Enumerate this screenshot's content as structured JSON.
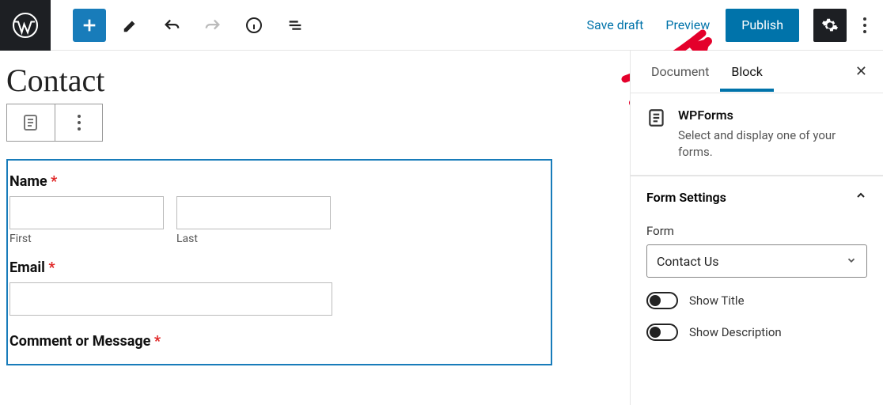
{
  "topbar": {
    "save_draft": "Save draft",
    "preview": "Preview",
    "publish": "Publish"
  },
  "page": {
    "title": "Contact"
  },
  "form": {
    "name_label": "Name",
    "first_label": "First",
    "last_label": "Last",
    "email_label": "Email",
    "comment_label": "Comment or Message",
    "required_marker": "*"
  },
  "sidebar": {
    "tabs": {
      "document": "Document",
      "block": "Block"
    },
    "block": {
      "name": "WPForms",
      "description": "Select and display one of your forms."
    },
    "panel": {
      "title": "Form Settings",
      "form_label": "Form",
      "form_selected": "Contact Us",
      "show_title": "Show Title",
      "show_description": "Show Description"
    }
  }
}
